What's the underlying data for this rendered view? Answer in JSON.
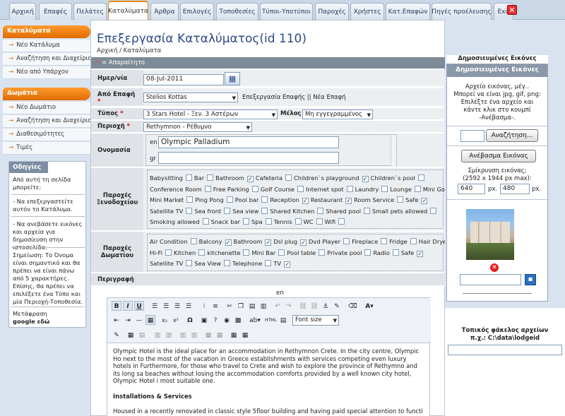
{
  "tabs": [
    "Αρχική",
    "Επαφές",
    "Πελάτες",
    "Καταλύματα",
    "Άρθρα",
    "Επιλογές",
    "Τοποθεσίες",
    "Τύποι-Υποτύποι",
    "Παροχές",
    "Χρήστες",
    "Κατ.Επαφών",
    "Πηγές προέλευσης",
    "Exit"
  ],
  "sidebar": {
    "section1": "Καταλύματα",
    "items1": [
      "Νέο Κατάλυμα",
      "Αναζήτηση και Διαχείριση",
      "Νέο από Υπάρχον"
    ],
    "section2": "Δωμάτια",
    "items2": [
      "Νέο Δωμάτιο",
      "Αναζήτηση και Διαχείριση",
      "Διαθεσιμότητες",
      "Τιμές"
    ],
    "help_title": "Οδηγίες",
    "help_intro": "Από αυτή τη σελίδα μπορείτε:",
    "help_1": "- Να επεξεργαστείτε αυτόν το Κατάλυμα.",
    "help_2": "- Να ανεβάσετε εικόνες και αρχεία για δημοσίευση στην ιστοσελίδα.",
    "help_note": "Σημείωση: Το Όνομα είναι σημαντικό και θα πρέπει να είναι πάνω από 5 χαρακτήρες. Επίσης, θα πρέπει να επιλέξετε ένα Τύπο και μία Περιοχή-Τοποθεσία.",
    "translate_label": "Μετάφραση",
    "google_label": "google εδώ"
  },
  "main": {
    "title": "Επεξεργασία Καταλύματος(id 110)",
    "breadcrumb": "Αρχική / Καταλύματα",
    "required_note": "= Απαραίτητο",
    "date_label": "Ημερ/νία",
    "date_value": "08-Jul-2011",
    "contact_label": "Από Επαφή",
    "contact_value": "Stelios Kottas",
    "contact_links": "Επεξεργασία Επαφής || Νέα Επαφή",
    "type_label": "Τύπος",
    "type_value": "3 Stars Hotel - Ξεν. 3 Αστέρων",
    "member_label": "Μέλος",
    "member_value": "Μη εγγεγραμμένος",
    "area_label": "Περιοχή",
    "area_value": "Rethymnon - Ρέθυμνο",
    "name_label": "Ονομασία",
    "lang_en": "en",
    "name_en": "Olympic Palladium",
    "lang_gr": "gr",
    "name_gr": "",
    "hotel_amenities_label": "Παροχές Ξενοδοχείου",
    "room_amenities_label": "Παροχές Δωματίου",
    "description_label": "Περιγραφή",
    "desc_lang": "en"
  },
  "hotel_amenities": [
    [
      [
        "Babysitting",
        false
      ],
      [
        "Bar",
        false
      ],
      [
        "Bathroom",
        true
      ],
      [
        "Cafeteria",
        false
      ],
      [
        "Children`s playground",
        true
      ],
      [
        "Children`s pool",
        false
      ]
    ],
    [
      [
        "Conference Room",
        false
      ],
      [
        "Free Parking",
        false
      ],
      [
        "Golf Course",
        false
      ],
      [
        "Internet spot",
        false
      ],
      [
        "Laundry",
        false
      ],
      [
        "Lounge",
        false
      ],
      [
        "Mini Golf",
        false
      ]
    ],
    [
      [
        "Mini Market",
        false
      ],
      [
        "Ping Pong",
        false
      ],
      [
        "Pool bar",
        false
      ],
      [
        "Reception",
        true
      ],
      [
        "Restaurant",
        true
      ],
      [
        "Room Service",
        false
      ],
      [
        "Safe",
        true
      ]
    ],
    [
      [
        "Satellite TV",
        false
      ],
      [
        "Sea front",
        false
      ],
      [
        "Sea view",
        false
      ],
      [
        "Shared Kitchen",
        false
      ],
      [
        "Shared pool",
        false
      ],
      [
        "Small pets allowed",
        false
      ]
    ],
    [
      [
        "Smoking allowed",
        false
      ],
      [
        "Snack bar",
        false
      ],
      [
        "Spa",
        false
      ],
      [
        "Tennis",
        false
      ],
      [
        "WC",
        false
      ],
      [
        "Wifi",
        false
      ]
    ]
  ],
  "room_amenities": [
    [
      [
        "Air Condition",
        false
      ],
      [
        "Balcony",
        true
      ],
      [
        "Bathroom",
        true
      ],
      [
        "Dsl plug",
        true
      ],
      [
        "Dvd Player",
        false
      ],
      [
        "Fireplace",
        false
      ],
      [
        "Fridge",
        false
      ],
      [
        "Hair Dryer",
        false
      ]
    ],
    [
      [
        "Hi-Fi",
        false
      ],
      [
        "Kitchen",
        false
      ],
      [
        "kitchenette",
        false
      ],
      [
        "Mini Bar",
        false
      ],
      [
        "Pool table",
        false
      ],
      [
        "Private pool",
        false
      ],
      [
        "Radio",
        false
      ],
      [
        "Safe",
        true
      ]
    ],
    [
      [
        "Satellite TV",
        false
      ],
      [
        "Sea View",
        false
      ],
      [
        "Telephone",
        false
      ],
      [
        "TV",
        true
      ]
    ]
  ],
  "editor": {
    "font_size_label": "Font size",
    "para1": "Olympic Hotel is the ideal place for an accommodation in Rethymnon Crete. In the city centre, Olympic Ho next to the most of the vacation in Greece establishments with services competing even luxury hotels in Furthermore, for those who travel to Crete and wish to explore the province of Rethymno and its long sa beaches without losing the accommodation comforts provided by a well known city hotel, Olympic Hotel i most suitable one.",
    "heading": "Installations & Services",
    "para2": "Housed in a recently renovated in classic style 5floor building and having paid special attention to functi"
  },
  "right": {
    "tab_label": "Δημοσιευμένες Εικόνες",
    "box_title": "Δημοσιευμένες Εικόνες",
    "instructions": [
      "Αρχείο εικόνας, μέγ..",
      "Μπορεί να είναι jpg, gif, png:",
      "Επιλέξτε ένα αρχείο και",
      "κάντε κλικ στο κουμπί",
      "-Ανέβασμα-."
    ],
    "browse_button": "Αναζήτηση...",
    "upload_button": "Ανέβασμα Εικόνας",
    "shrink_label": "Σμίκρυνση εικόνας;",
    "shrink_max": "(2592 x 1944 px max):",
    "width_value": "640",
    "height_value": "480",
    "px": "px.",
    "local_folder_label": "Τοπικός φάκελος αρχείων",
    "local_folder_example": "π.χ.: C:\\data\\lodgeid"
  },
  "colors": {
    "accent": "#e06b00",
    "title": "#2c4a86",
    "header_gray": "#7d8a98"
  }
}
